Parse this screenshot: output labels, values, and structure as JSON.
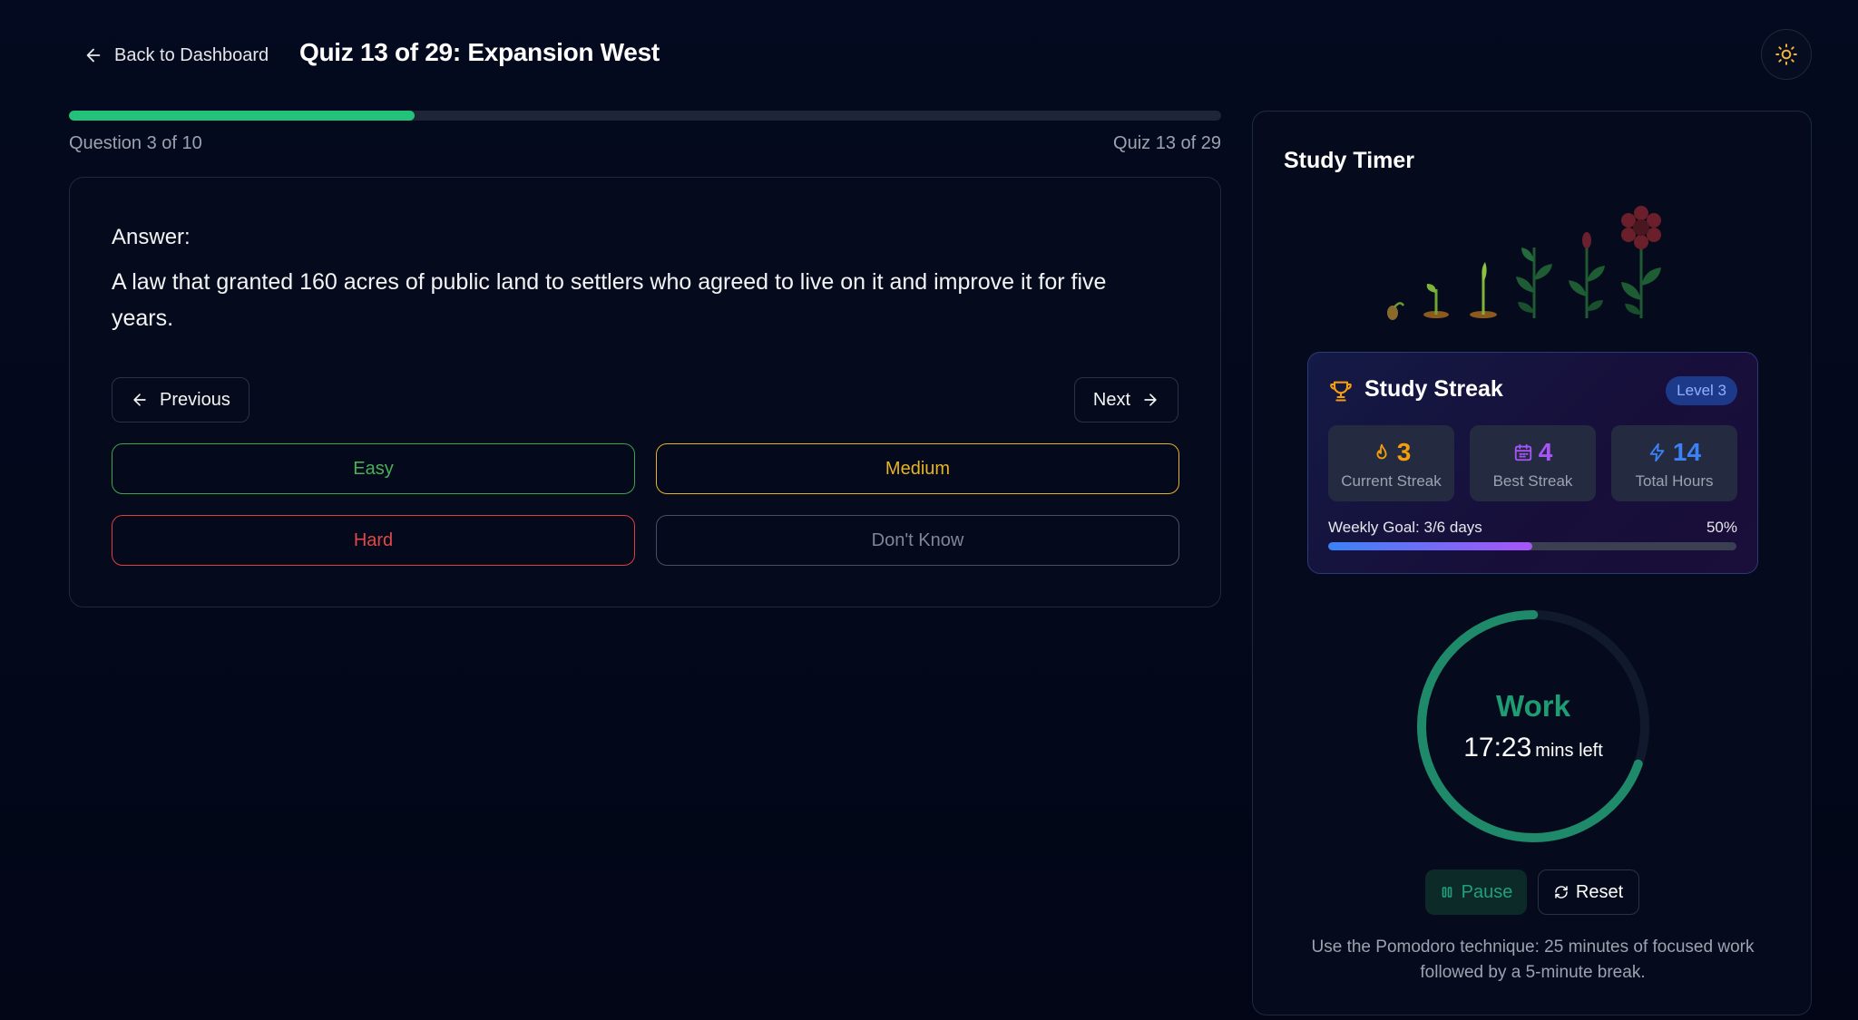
{
  "header": {
    "back_label": "Back to Dashboard",
    "title": "Quiz 13 of 29: Expansion West"
  },
  "progress": {
    "fraction": 0.3,
    "question_label": "Question 3 of 10",
    "quiz_label": "Quiz 13 of 29"
  },
  "card": {
    "answer_label": "Answer:",
    "answer_text": "A law that granted 160 acres of public land to settlers who agreed to live on it and improve it for five years.",
    "previous_label": "Previous",
    "next_label": "Next",
    "difficulty": {
      "easy": "Easy",
      "medium": "Medium",
      "hard": "Hard",
      "dont_know": "Don't Know"
    }
  },
  "timer": {
    "title": "Study Timer",
    "streak": {
      "title": "Study Streak",
      "level": "Level 3",
      "current_value": "3",
      "current_label": "Current Streak",
      "best_value": "4",
      "best_label": "Best Streak",
      "hours_value": "14",
      "hours_label": "Total Hours",
      "weekly_label": "Weekly Goal: 3/6 days",
      "weekly_pct": "50%",
      "weekly_fraction": 0.5
    },
    "mode": "Work",
    "time_left": "17:23",
    "time_unit": "mins left",
    "remaining_fraction": 0.695,
    "pause_label": "Pause",
    "reset_label": "Reset",
    "tip": "Use the Pomodoro technique: 25 minutes of focused work followed by a 5-minute break."
  },
  "colors": {
    "progress": "#22c27a",
    "ring": "#1f9d72",
    "easy": "#4cae58",
    "medium": "#e7b224",
    "hard": "#e24848"
  }
}
